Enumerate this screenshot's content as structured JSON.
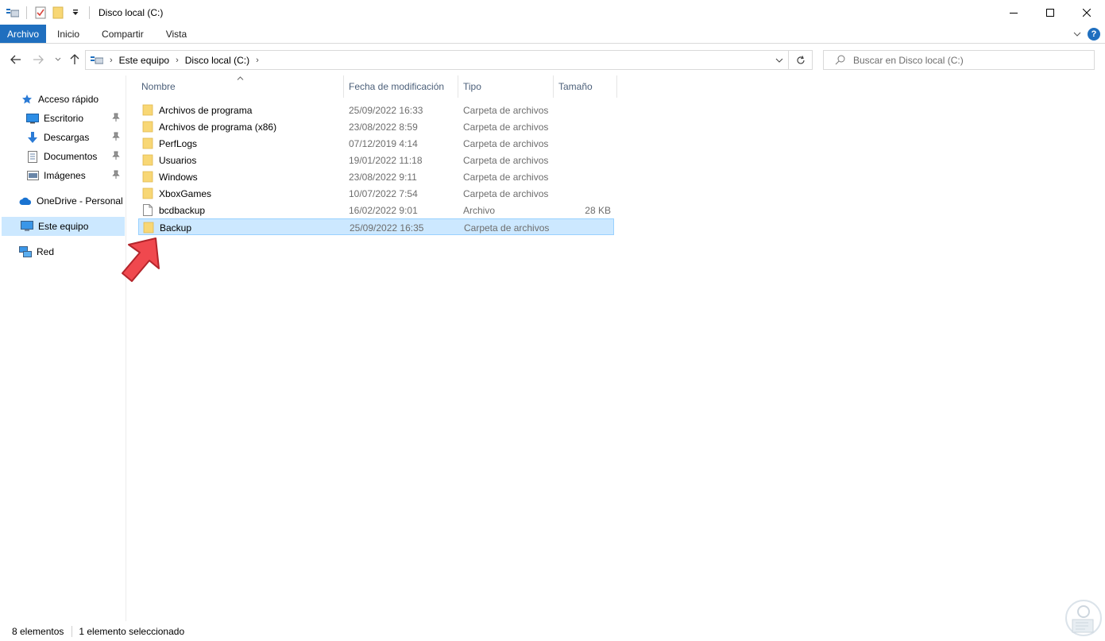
{
  "window": {
    "title": "Disco local (C:)"
  },
  "ribbon": {
    "tabs": [
      "Archivo",
      "Inicio",
      "Compartir",
      "Vista"
    ]
  },
  "address": {
    "crumbs": [
      "Este equipo",
      "Disco local (C:)"
    ],
    "search_placeholder": "Buscar en Disco local (C:)"
  },
  "nav": {
    "items": [
      {
        "label": "Acceso rápido",
        "icon": "star-icon",
        "pinned": false
      },
      {
        "label": "Escritorio",
        "icon": "desktop-icon",
        "pinned": true
      },
      {
        "label": "Descargas",
        "icon": "download-icon",
        "pinned": true
      },
      {
        "label": "Documentos",
        "icon": "document-icon",
        "pinned": true
      },
      {
        "label": "Imágenes",
        "icon": "pictures-icon",
        "pinned": true
      },
      {
        "label": "OneDrive - Personal",
        "icon": "cloud-icon",
        "pinned": false
      },
      {
        "label": "Este equipo",
        "icon": "computer-icon",
        "pinned": false,
        "selected": true
      },
      {
        "label": "Red",
        "icon": "network-icon",
        "pinned": false
      }
    ]
  },
  "columns": {
    "name": "Nombre",
    "date": "Fecha de modificación",
    "type": "Tipo",
    "size": "Tamaño"
  },
  "files": [
    {
      "name": "Archivos de programa",
      "date": "25/09/2022 16:33",
      "type": "Carpeta de archivos",
      "size": "",
      "kind": "folder"
    },
    {
      "name": "Archivos de programa (x86)",
      "date": "23/08/2022 8:59",
      "type": "Carpeta de archivos",
      "size": "",
      "kind": "folder"
    },
    {
      "name": "PerfLogs",
      "date": "07/12/2019 4:14",
      "type": "Carpeta de archivos",
      "size": "",
      "kind": "folder"
    },
    {
      "name": "Usuarios",
      "date": "19/01/2022 11:18",
      "type": "Carpeta de archivos",
      "size": "",
      "kind": "folder"
    },
    {
      "name": "Windows",
      "date": "23/08/2022 9:11",
      "type": "Carpeta de archivos",
      "size": "",
      "kind": "folder"
    },
    {
      "name": "XboxGames",
      "date": "10/07/2022 7:54",
      "type": "Carpeta de archivos",
      "size": "",
      "kind": "folder"
    },
    {
      "name": "bcdbackup",
      "date": "16/02/2022 9:01",
      "type": "Archivo",
      "size": "28 KB",
      "kind": "file"
    },
    {
      "name": "Backup",
      "date": "25/09/2022 16:35",
      "type": "Carpeta de archivos",
      "size": "",
      "kind": "folder",
      "selected": true
    }
  ],
  "status": {
    "count": "8 elementos",
    "selection": "1 elemento seleccionado"
  },
  "colors": {
    "accent": "#1f6fbf",
    "selection": "#cce8ff",
    "folder": "#f8d775",
    "arrow": "#f0484e"
  }
}
